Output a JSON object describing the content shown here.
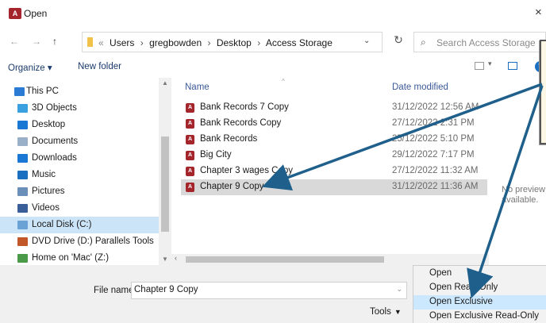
{
  "window": {
    "title": "Open",
    "close_glyph": "×"
  },
  "address": {
    "back_glyph": "←",
    "forward_glyph": "→",
    "up_glyph": "↑",
    "overflow_glyph": "«",
    "crumbs": [
      "Users",
      "gregbowden",
      "Desktop",
      "Access Storage"
    ],
    "separator": "›",
    "dropdown_glyph": "⌄",
    "refresh_glyph": "↻",
    "search_placeholder": "Search Access Storage"
  },
  "toolbar": {
    "organize": "Organize ▾",
    "new_folder": "New folder",
    "help_glyph": "?"
  },
  "nav": {
    "items": [
      {
        "label": "This PC",
        "icon": "computer-icon",
        "color": "#2b7bd4"
      },
      {
        "label": "3D Objects",
        "icon": "cube-icon",
        "color": "#3aa0e0"
      },
      {
        "label": "Desktop",
        "icon": "desktop-icon",
        "color": "#1a78d4"
      },
      {
        "label": "Documents",
        "icon": "document-icon",
        "color": "#9ab0c8"
      },
      {
        "label": "Downloads",
        "icon": "download-icon",
        "color": "#1a78d4"
      },
      {
        "label": "Music",
        "icon": "music-icon",
        "color": "#1a6fc0"
      },
      {
        "label": "Pictures",
        "icon": "pictures-icon",
        "color": "#6a8fb8"
      },
      {
        "label": "Videos",
        "icon": "videos-icon",
        "color": "#3a5f98"
      },
      {
        "label": "Local Disk (C:)",
        "icon": "disk-icon",
        "color": "#6aa2d6"
      },
      {
        "label": "DVD Drive (D:) Parallels Tools",
        "icon": "dvd-icon",
        "color": "#c0582a"
      },
      {
        "label": "Home on 'Mac' (Z:)",
        "icon": "network-drive-icon",
        "color": "#4a9a4a"
      }
    ]
  },
  "files": {
    "headers": {
      "name": "Name",
      "date": "Date modified"
    },
    "rows": [
      {
        "name": "Bank Records 7 Copy",
        "date": "31/12/2022 12:56 AM"
      },
      {
        "name": "Bank Records Copy",
        "date": "27/12/2022 2:31 PM"
      },
      {
        "name": "Bank Records",
        "date": "25/12/2022 5:10 PM"
      },
      {
        "name": "Big City",
        "date": "29/12/2022 7:17 PM"
      },
      {
        "name": "Chapter 3 wages Copy",
        "date": "27/12/2022 11:32 AM"
      },
      {
        "name": "Chapter 9 Copy",
        "date": "31/12/2022 11:36 AM"
      }
    ],
    "file_icon_letter": "A"
  },
  "preview": {
    "text": "No preview available."
  },
  "bottom": {
    "file_name_label": "File name:",
    "file_name_value": "Chapter 9 Copy",
    "tools_label": "Tools"
  },
  "open_menu": {
    "items": [
      "Open",
      "Open Read-Only",
      "Open Exclusive",
      "Open Exclusive Read-Only"
    ],
    "hover_index": 2
  },
  "annotation_color": "#1f5f8b"
}
